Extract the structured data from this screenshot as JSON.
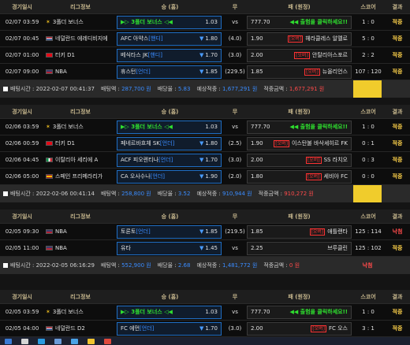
{
  "headers": {
    "time": "경기일시",
    "league": "리그정보",
    "home": "승 (홈)",
    "draw": "무",
    "away": "패 (원정)",
    "score": "스코어",
    "result": "결과"
  },
  "blocks": [
    {
      "rows": [
        {
          "time": "02/07 03:59",
          "league": "3폴더 보너스",
          "league_icon": "star-icon",
          "home": "▶▷ 3폴더 보너스 ◁◀",
          "home_promo": true,
          "home_odds": "1.03",
          "draw": "vs",
          "away_odds": "777.70",
          "away": "◀◀ 출험을 클릭하세요!!",
          "away_promo": true,
          "score": "1 : 0",
          "result": "적중",
          "selected": "home"
        },
        {
          "time": "02/07 00:45",
          "league": "네덜란드 에레디비지에",
          "league_icon": "flag-netherlands",
          "home": "AFC 아약스",
          "home_handi": "[핸디]",
          "home_odds": "1.80",
          "draw": "(4.0)",
          "away_odds": "1.90",
          "away": "헤라클레스 알멜로",
          "away_bonus": "[오버]",
          "score": "5 : 0",
          "result": "적중",
          "selected": "home"
        },
        {
          "time": "02/07 01:00",
          "league": "터키 D1",
          "league_icon": "flag-turkey",
          "home": "베식타스 JK",
          "home_handi": "[핸디]",
          "home_odds": "1.70",
          "draw": "(3.0)",
          "away_odds": "2.00",
          "away": "안탈리아스포르",
          "away_bonus": "[오버]",
          "score": "2 : 2",
          "result": "적중",
          "selected": "home"
        },
        {
          "time": "02/07 09:00",
          "league": "NBA",
          "league_icon": "flag-usa",
          "home": "휴스턴",
          "home_handi": "[언더]",
          "home_odds": "1.85",
          "draw": "(229.5)",
          "away_odds": "1.85",
          "away": "뉴올리언스",
          "away_bonus": "[오버]",
          "score": "107 : 120",
          "result": "적중",
          "selected": "home"
        }
      ],
      "footer": {
        "bet_time_label": "배팅시간 :",
        "bet_time": "2022-02-07 00:41:37",
        "stake_label": "배팅액 :",
        "stake": "287,700 원",
        "odds_label": "배당율 :",
        "odds": "5.83",
        "expected_label": "예상적중 :",
        "expected": "1,677,291 원",
        "win_label": "적중금액 :",
        "win": "1,677,291 원",
        "result_state": "win"
      }
    },
    {
      "rows": [
        {
          "time": "02/06 03:59",
          "league": "3폴더 보너스",
          "league_icon": "star-icon",
          "home": "▶▷ 3폴더 보너스 ◁◀",
          "home_promo": true,
          "home_odds": "1.03",
          "draw": "vs",
          "away_odds": "777.70",
          "away": "◀◀ 출험을 클릭하세요!!",
          "away_promo": true,
          "score": "1 : 0",
          "result": "적중",
          "selected": "home"
        },
        {
          "time": "02/06 00:59",
          "league": "터키 D1",
          "league_icon": "flag-turkey",
          "home": "페네르바흐체 SK",
          "home_handi": "[언더]",
          "home_odds": "1.80",
          "draw": "(2.5)",
          "away_odds": "1.90",
          "away": "이스탄불 바삭셰히르 FK",
          "away_bonus": "[오버]",
          "score": "0 : 1",
          "result": "적중",
          "selected": "home"
        },
        {
          "time": "02/06 04:45",
          "league": "이탈리아 세리에 A",
          "league_icon": "flag-italy",
          "home": "ACF 피오렌티나",
          "home_handi": "[언더]",
          "home_odds": "1.70",
          "draw": "(3.0)",
          "away_odds": "2.00",
          "away": "SS 라치오",
          "away_bonus": "[오버]",
          "score": "0 : 3",
          "result": "적중",
          "selected": "home"
        },
        {
          "time": "02/06 05:00",
          "league": "스페인 프리메라리가",
          "league_icon": "flag-spain",
          "home": "CA 오사수나",
          "home_handi": "[언더]",
          "home_odds": "1.90",
          "draw": "(2.0)",
          "away_odds": "1.80",
          "away": "세비야 FC",
          "away_bonus": "[오버]",
          "score": "0 : 0",
          "result": "적중",
          "selected": "home"
        }
      ],
      "footer": {
        "bet_time_label": "배팅시간 :",
        "bet_time": "2022-02-06 00:41:14",
        "stake_label": "배팅액 :",
        "stake": "258,800 원",
        "odds_label": "배당율 :",
        "odds": "3.52",
        "expected_label": "예상적중 :",
        "expected": "910,944 원",
        "win_label": "적중금액 :",
        "win": "910,272 원",
        "result_state": "win"
      }
    },
    {
      "rows": [
        {
          "time": "02/05 09:30",
          "league": "NBA",
          "league_icon": "flag-usa",
          "home": "토론토",
          "home_handi": "[언더]",
          "home_odds": "1.85",
          "draw": "(219.5)",
          "away_odds": "1.85",
          "away": "애틀랜타",
          "away_bonus": "[오버]",
          "score": "125 : 114",
          "result": "낙첨",
          "selected": "home"
        },
        {
          "time": "02/05 11:00",
          "league": "NBA",
          "league_icon": "flag-usa",
          "home": "유타",
          "home_handi": "",
          "home_odds": "1.45",
          "draw": "vs",
          "away_odds": "2.25",
          "away": "브루클린",
          "away_bonus": "",
          "score": "125 : 102",
          "result": "적중",
          "selected": "home"
        }
      ],
      "footer": {
        "bet_time_label": "배팅시간 :",
        "bet_time": "2022-02-05 06:16:29",
        "stake_label": "배팅액 :",
        "stake": "552,900 원",
        "odds_label": "배당율 :",
        "odds": "2.68",
        "expected_label": "예상적중 :",
        "expected": "1,481,772 원",
        "win_label": "적중금액 :",
        "win": "0 원",
        "result_state": "lose",
        "result_text": "낙첨"
      }
    },
    {
      "rows": [
        {
          "time": "02/05 03:59",
          "league": "3폴더 보너스",
          "league_icon": "star-icon",
          "home": "▶▷ 3폴더 보너스 ◁◀",
          "home_promo": true,
          "home_odds": "1.03",
          "draw": "vs",
          "away_odds": "777.70",
          "away": "◀◀ 출험을 클릭하세요!!",
          "away_promo": true,
          "score": "1 : 0",
          "result": "적중",
          "selected": "home"
        },
        {
          "time": "02/05 04:00",
          "league": "네덜란드 D2",
          "league_icon": "flag-netherlands",
          "home": "FC 에먼",
          "home_handi": "[언더]",
          "home_odds": "1.70",
          "draw": "(3.0)",
          "away_odds": "2.00",
          "away": "FC 오스",
          "away_bonus": "[오버]",
          "score": "3 : 1",
          "result": "적중",
          "selected": "home"
        }
      ]
    }
  ],
  "colors": {
    "win": "#ffd24a",
    "lose": "#ff4b4b",
    "handi": "#3a8cff",
    "promo": "#2fe02f",
    "accent_border": "#1f6dc2",
    "footer_bg": "#2a2a2a",
    "result_box": "#f0cc2c"
  }
}
